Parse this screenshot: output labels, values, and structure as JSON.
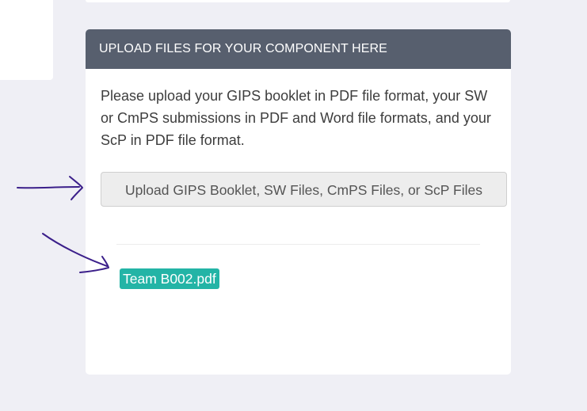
{
  "panel": {
    "header_title": "UPLOAD FILES FOR YOUR COMPONENT HERE",
    "instructions": "Please upload your GIPS booklet in PDF file format, your SW or CmPS submissions in PDF and Word file formats, and your ScP in PDF file format.",
    "upload_button_label": "Upload GIPS Booklet, SW Files, CmPS Files, or ScP Files",
    "uploaded_file": "Team B002.pdf"
  },
  "annotations": {
    "arrow_color": "#3b1f8a"
  },
  "colors": {
    "page_background": "#efeff5",
    "header_background": "#575f6e",
    "file_chip": "#23b4a6"
  }
}
